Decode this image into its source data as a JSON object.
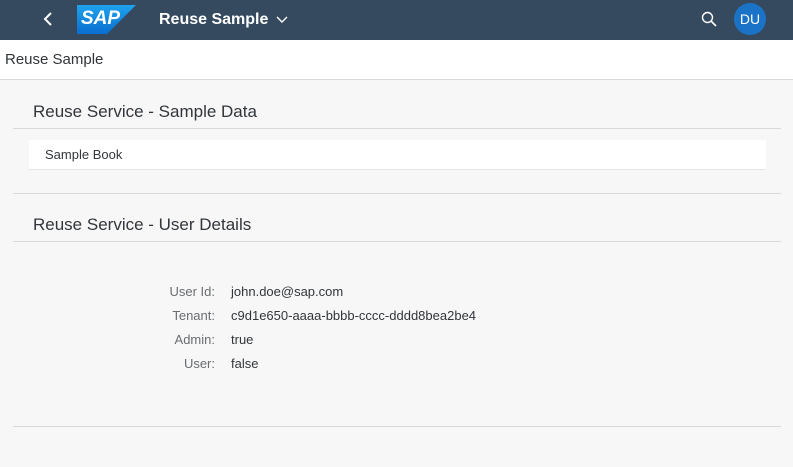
{
  "shell": {
    "logo_text": "SAP",
    "app_title": "Reuse Sample",
    "avatar_initials": "DU",
    "colors": {
      "header_bg": "#354a5f",
      "avatar_bg": "#1a73c7",
      "logo_blue": "#1a8fd8"
    },
    "icons": {
      "back": "chevron-left-icon",
      "title_menu": "chevron-down-icon",
      "search": "search-icon"
    }
  },
  "page": {
    "title": "Reuse Sample"
  },
  "sections": {
    "sample_data": {
      "title": "Reuse Service - Sample Data",
      "items": [
        "Sample Book"
      ]
    },
    "user_details": {
      "title": "Reuse Service - User Details",
      "fields": [
        {
          "label": "User Id:",
          "value": "john.doe@sap.com"
        },
        {
          "label": "Tenant:",
          "value": "c9d1e650-aaaa-bbbb-cccc-dddd8bea2be4"
        },
        {
          "label": "Admin:",
          "value": "true"
        },
        {
          "label": "User:",
          "value": "false"
        }
      ]
    }
  }
}
